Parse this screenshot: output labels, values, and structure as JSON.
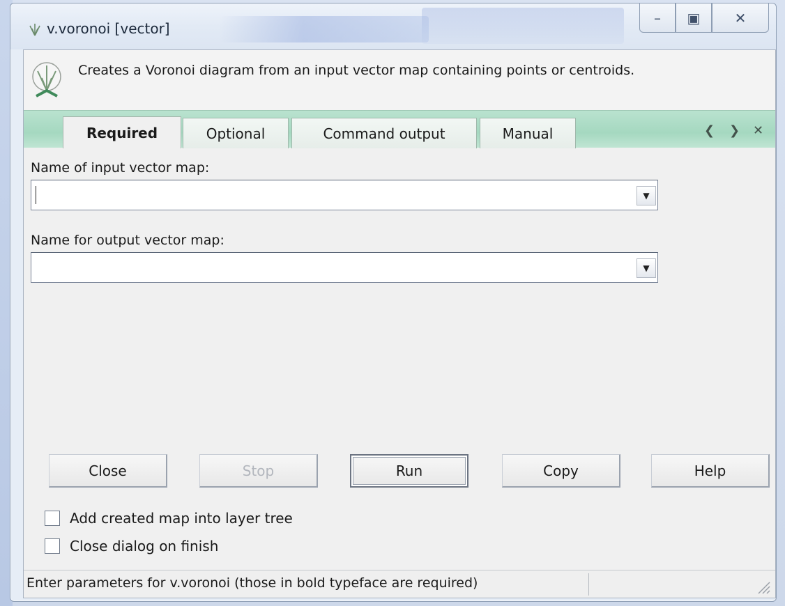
{
  "window": {
    "title": "v.voronoi [vector]",
    "controls": {
      "minimize": "–",
      "maximize": "▣",
      "close": "✕"
    }
  },
  "description": "Creates a Voronoi diagram from an input vector map containing points or centroids.",
  "tabs": [
    {
      "label": "Required",
      "active": true
    },
    {
      "label": "Optional",
      "active": false
    },
    {
      "label": "Command output",
      "active": false
    },
    {
      "label": "Manual",
      "active": false
    }
  ],
  "tab_controls": {
    "left": "❮",
    "right": "❯",
    "close": "✕"
  },
  "fields": {
    "input": {
      "label": "Name of input vector map:",
      "value": ""
    },
    "output": {
      "label": "Name for output vector map:",
      "value": ""
    }
  },
  "buttons": {
    "close": "Close",
    "stop": "Stop",
    "run": "Run",
    "copy": "Copy",
    "help": "Help"
  },
  "checkboxes": [
    {
      "label": "Add created map into layer tree",
      "checked": false
    },
    {
      "label": "Close dialog on finish",
      "checked": false
    }
  ],
  "status": "Enter parameters for v.voronoi (those in bold typeface are required)"
}
